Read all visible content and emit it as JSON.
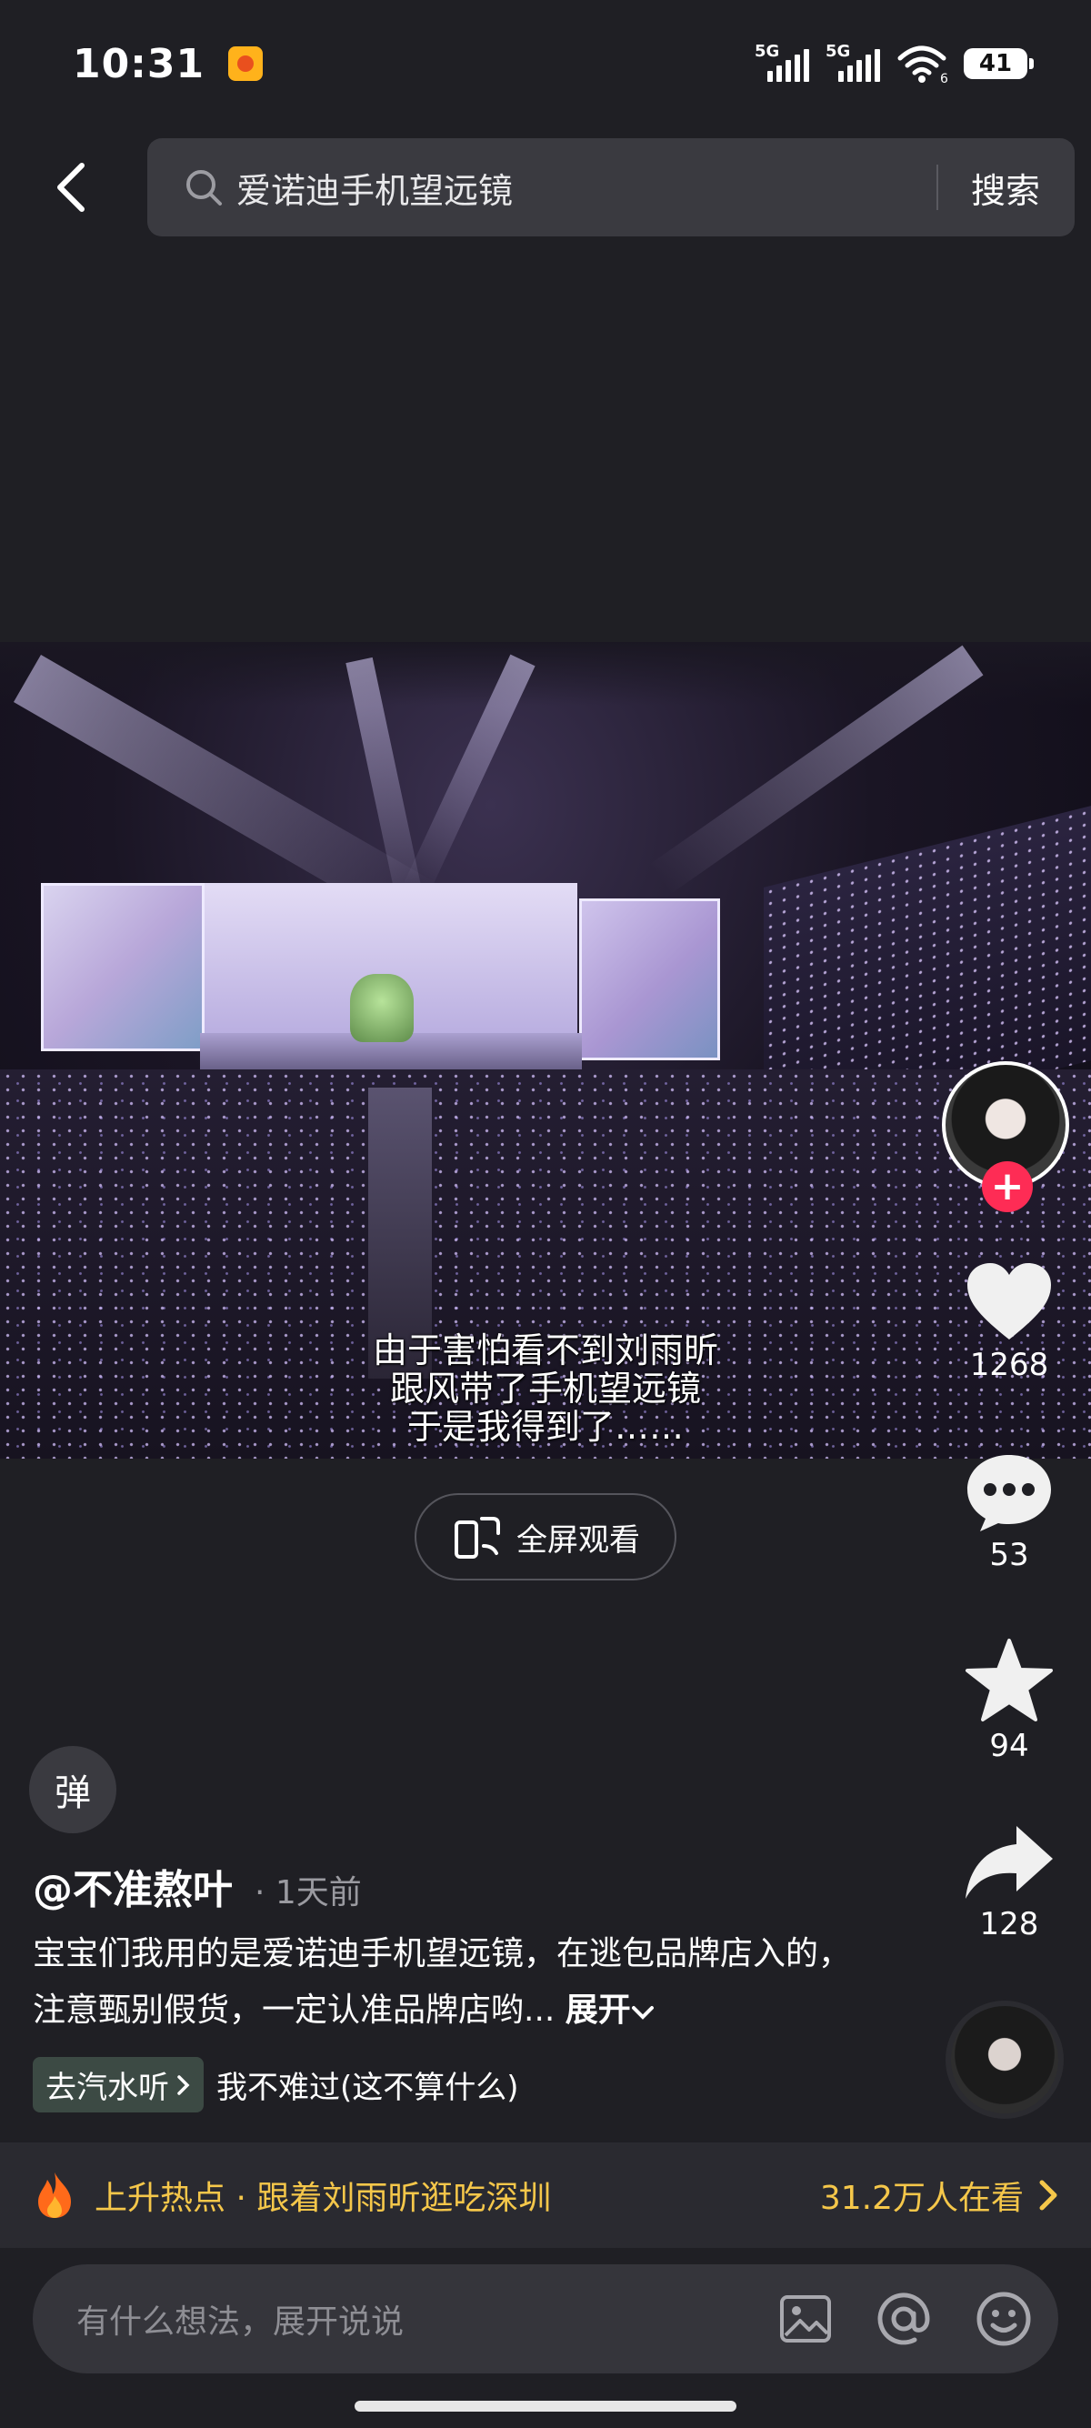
{
  "status_bar": {
    "time": "10:31",
    "network_1": "5G",
    "network_2": "5G",
    "wifi_label": "6",
    "battery": "41"
  },
  "search": {
    "query": "爱诺迪手机望远镜",
    "button_label": "搜索"
  },
  "video": {
    "subtitle_lines": [
      "由于害怕看不到刘雨昕",
      "跟风带了手机望远镜",
      "于是我得到了……"
    ]
  },
  "actions": {
    "likes": "1268",
    "comments": "53",
    "favorites": "94",
    "shares": "128"
  },
  "fullscreen_label": "全屏观看",
  "danmaku_label": "弹",
  "post": {
    "author": "@不准熬叶",
    "time": "· 1天前",
    "description": "宝宝们我用的是爱诺迪手机望远镜，在逃包品牌店入的，注意甄别假货，一定认准品牌店哟...",
    "expand_label": "展开",
    "music_tag": "去汽水听",
    "music_title": "我不难过(这不算什么)"
  },
  "hot_banner": {
    "text": "上升热点 · 跟着刘雨昕逛吃深圳",
    "viewers": "31.2万人在看"
  },
  "comment": {
    "placeholder": "有什么想法，展开说说"
  },
  "colors": {
    "accent_red": "#fe2c55",
    "hot_yellow": "#f5c74a",
    "background": "#1f1f24"
  }
}
